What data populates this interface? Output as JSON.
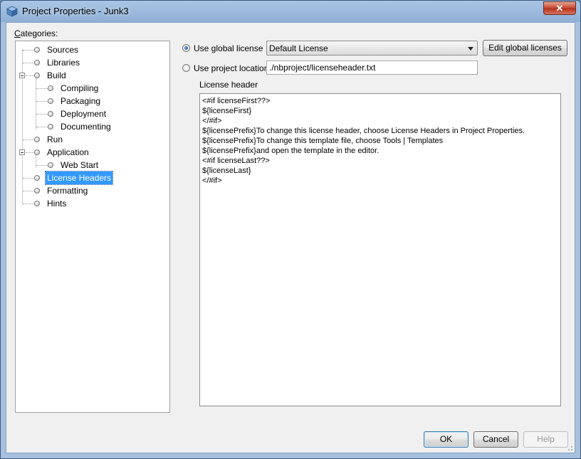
{
  "window": {
    "title": "Project Properties - Junk3",
    "close_glyph": "✕"
  },
  "categories": {
    "label_mnemonic": "C",
    "label_rest": "ategories:",
    "items": [
      {
        "label": "Sources"
      },
      {
        "label": "Libraries"
      },
      {
        "label": "Build"
      },
      {
        "label": "Compiling"
      },
      {
        "label": "Packaging"
      },
      {
        "label": "Deployment"
      },
      {
        "label": "Documenting"
      },
      {
        "label": "Run"
      },
      {
        "label": "Application"
      },
      {
        "label": "Web Start"
      },
      {
        "label": "License Headers"
      },
      {
        "label": "Formatting"
      },
      {
        "label": "Hints"
      }
    ],
    "selected": "License Headers"
  },
  "license": {
    "global_radio_label": "Use global license",
    "global_selected": true,
    "global_combo_value": "Default License",
    "edit_global_button": "Edit global licenses",
    "project_radio_label": "Use project location",
    "project_location_value": "./nbproject/licenseheader.txt",
    "header_label": "License header",
    "header_lines": [
      "<#if licenseFirst??>",
      "${licenseFirst}",
      "</#if>",
      "${licensePrefix}To change this license header, choose License Headers in Project Properties.",
      "${licensePrefix}To change this template file, choose Tools | Templates",
      "${licensePrefix}and open the template in the editor.",
      "<#if licenseLast??>",
      "${licenseLast}",
      "</#if>"
    ]
  },
  "buttons": {
    "ok": "OK",
    "cancel": "Cancel",
    "help": "Help"
  }
}
